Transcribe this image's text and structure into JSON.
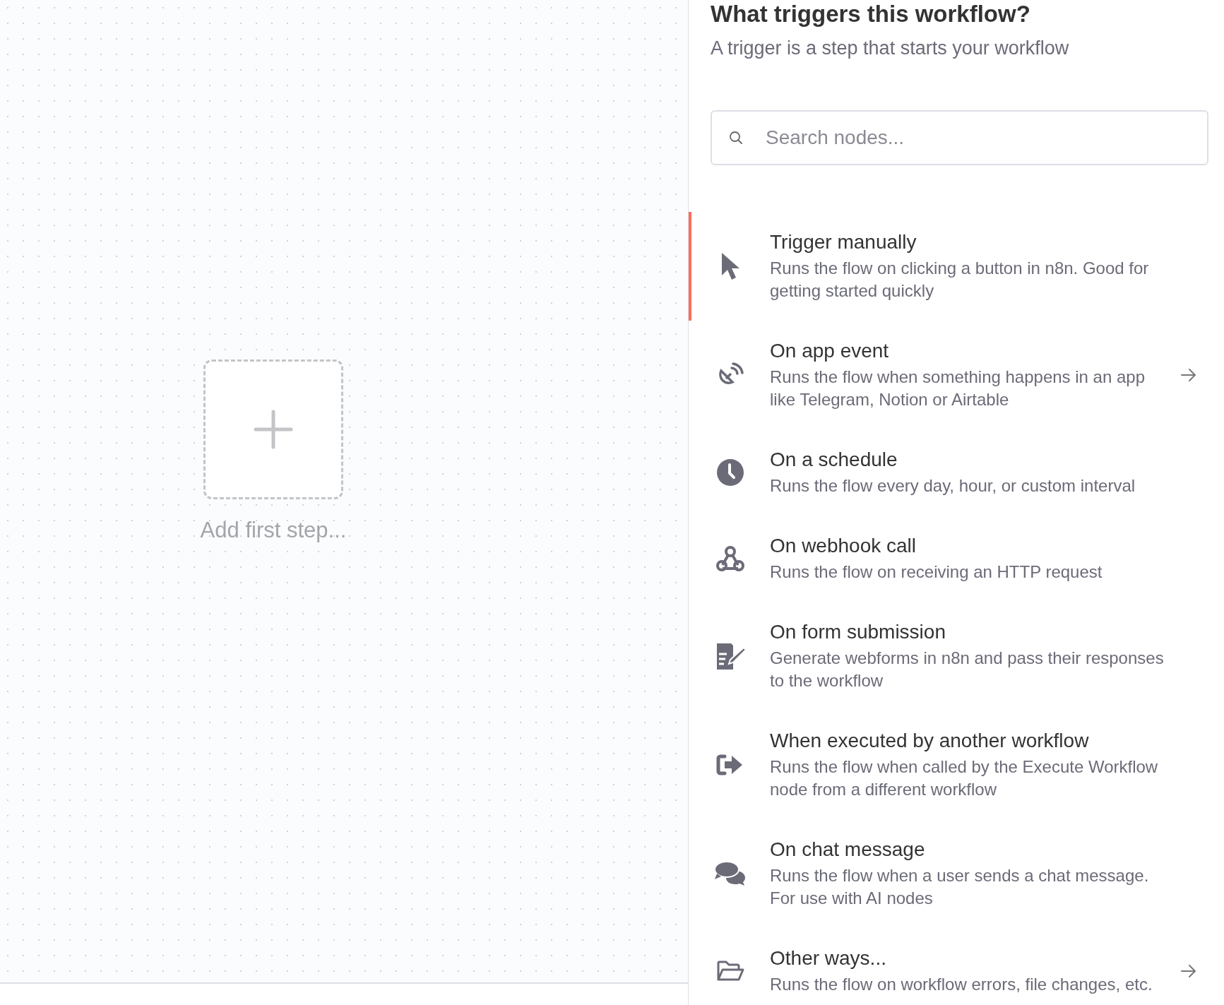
{
  "canvas": {
    "add_step_label": "Add first step..."
  },
  "panel": {
    "title": "What triggers this workflow?",
    "subtitle": "A trigger is a step that starts your workflow",
    "search": {
      "placeholder": "Search nodes..."
    },
    "items": [
      {
        "kind": "cursor",
        "title": "Trigger manually",
        "description": "Runs the flow on clicking a button in n8n. Good for getting started quickly",
        "selected": true,
        "arrow": false
      },
      {
        "kind": "satellite",
        "title": "On app event",
        "description": "Runs the flow when something happens in an app like Telegram, Notion or Airtable",
        "selected": false,
        "arrow": true
      },
      {
        "kind": "clock",
        "title": "On a schedule",
        "description": "Runs the flow every day, hour, or custom interval",
        "selected": false,
        "arrow": false
      },
      {
        "kind": "webhook",
        "title": "On webhook call",
        "description": "Runs the flow on receiving an HTTP request",
        "selected": false,
        "arrow": false
      },
      {
        "kind": "form",
        "title": "On form submission",
        "description": "Generate webforms in n8n and pass their responses to the workflow",
        "selected": false,
        "arrow": false
      },
      {
        "kind": "exit",
        "title": "When executed by another workflow",
        "description": "Runs the flow when called by the Execute Workflow node from a different workflow",
        "selected": false,
        "arrow": false
      },
      {
        "kind": "chat",
        "title": "On chat message",
        "description": "Runs the flow when a user sends a chat message. For use with AI nodes",
        "selected": false,
        "arrow": false
      },
      {
        "kind": "folder",
        "title": "Other ways...",
        "description": "Runs the flow on workflow errors, file changes, etc.",
        "selected": false,
        "arrow": true
      }
    ]
  }
}
